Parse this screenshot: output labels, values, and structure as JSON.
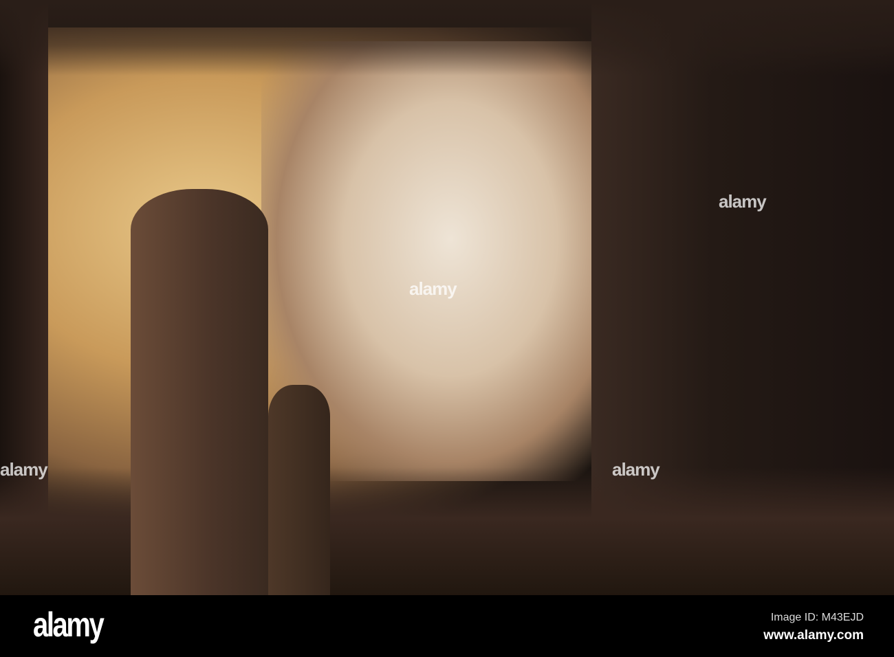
{
  "photo": {
    "subject": "cave interior"
  },
  "watermark": {
    "text": "alamy"
  },
  "footer": {
    "logo": "alamy",
    "image_id": "Image ID: M43EJD",
    "website": "www.alamy.com"
  }
}
